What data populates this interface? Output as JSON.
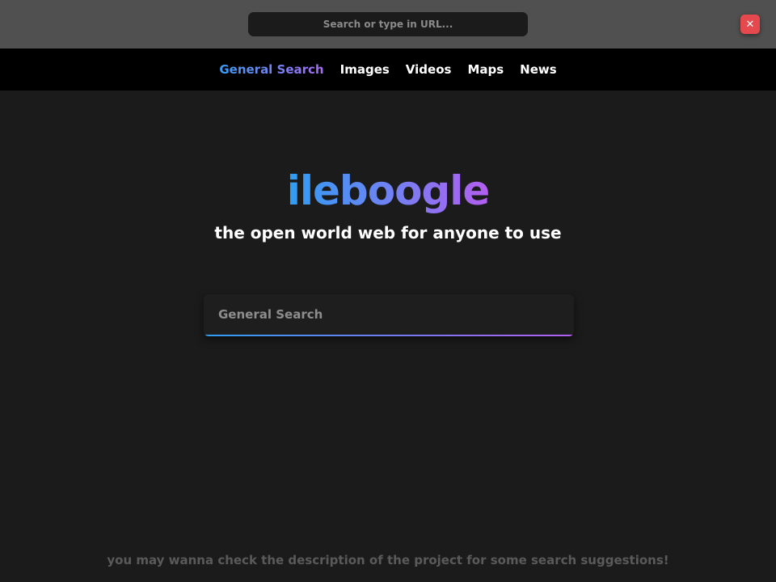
{
  "browser": {
    "url_placeholder": "Search or type in URL...",
    "close_label": "✕"
  },
  "nav": {
    "items": [
      {
        "label": "General Search",
        "active": true
      },
      {
        "label": "Images",
        "active": false
      },
      {
        "label": "Videos",
        "active": false
      },
      {
        "label": "Maps",
        "active": false
      },
      {
        "label": "News",
        "active": false
      }
    ]
  },
  "hero": {
    "logo": "ileboogle",
    "tagline": "the open world web for anyone to use"
  },
  "search": {
    "placeholder": "General Search",
    "value": ""
  },
  "footer": {
    "hint": "you may wanna check the description of the project for some search suggestions!"
  },
  "colors": {
    "background": "#1b1b1b",
    "nav_background": "#000000",
    "browser_bar": "#505050",
    "gradient_start": "#2f9df3",
    "gradient_end": "#b35ef0",
    "close_button": "#e5484d"
  }
}
